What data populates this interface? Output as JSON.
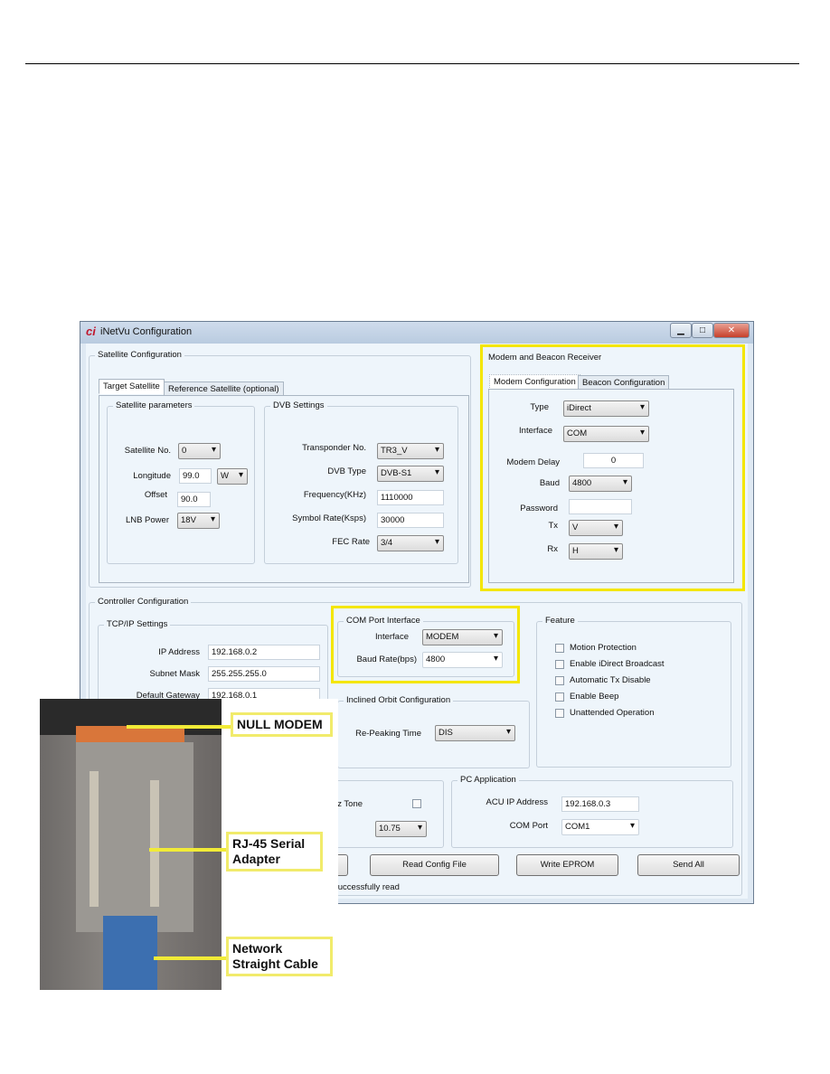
{
  "window": {
    "title": "iNetVu Configuration",
    "logo": "ci",
    "controls": [
      "minimize-icon",
      "maximize-icon",
      "close-icon"
    ],
    "control_glyphs": [
      "▁",
      "□",
      "✕"
    ]
  },
  "satellite": {
    "group": "Satellite Configuration",
    "tabs": [
      "Target Satellite",
      "Reference Satellite (optional)"
    ],
    "params": {
      "group": "Satellite parameters",
      "sat_no_label": "Satellite No.",
      "sat_no": "0",
      "longitude_label": "Longitude",
      "longitude": "99.0",
      "hemisphere": "W",
      "offset_label": "Offset",
      "offset": "90.0",
      "lnb_label": "LNB Power",
      "lnb": "18V"
    },
    "dvb": {
      "group": "DVB Settings",
      "transponder_label": "Transponder No.",
      "transponder": "TR3_V",
      "type_label": "DVB Type",
      "type": "DVB-S1",
      "freq_label": "Frequency(KHz)",
      "freq": "1110000",
      "symbol_label": "Symbol Rate(Ksps)",
      "symbol": "30000",
      "fec_label": "FEC Rate",
      "fec": "3/4"
    }
  },
  "modem": {
    "group": "Modem and Beacon Receiver",
    "tabs": [
      "Modem Configuration",
      "Beacon Configuration"
    ],
    "type_label": "Type",
    "type": "iDirect",
    "interface_label": "Interface",
    "interface": "COM",
    "delay_label": "Modem Delay",
    "delay": "0",
    "baud_label": "Baud",
    "baud": "4800",
    "password_label": "Password",
    "password": "",
    "tx_label": "Tx",
    "tx": "V",
    "rx_label": "Rx",
    "rx": "H"
  },
  "controller": {
    "group": "Controller Configuration",
    "tcpip": {
      "group": "TCP/IP Settings",
      "ip_label": "IP Address",
      "ip": "192.168.0.2",
      "mask_label": "Subnet Mask",
      "mask": "255.255.255.0",
      "gw_label": "Default Gateway",
      "gw": "192.168.0.1"
    },
    "com": {
      "group": "COM Port Interface",
      "interface_label": "Interface",
      "interface": "MODEM",
      "baud_label": "Baud Rate(bps)",
      "baud": "4800"
    },
    "orbit": {
      "group": "Inclined Orbit Configuration",
      "repeak_label": "Re-Peaking Time",
      "repeak": "DIS"
    },
    "feature": {
      "group": "Feature",
      "items": [
        "Motion Protection",
        "Enable iDirect Broadcast",
        "Automatic Tx Disable",
        "Enable Beep",
        "Unattended Operation"
      ]
    },
    "lnb": {
      "tone_label": "KHz Tone",
      "lo_value": "10.75"
    },
    "pc": {
      "group": "PC Application",
      "acu_label": "ACU IP Address",
      "acu": "192.168.0.3",
      "com_label": "COM Port",
      "com": "COM1"
    }
  },
  "buttons": {
    "read": "Read Config File",
    "write": "Write EPROM",
    "send": "Send All"
  },
  "status": "successfully read",
  "callouts": {
    "null_modem": "NULL MODEM",
    "rj45": "RJ-45 Serial Adapter",
    "cable": "Network Straight Cable"
  },
  "colors": {
    "highlight": "#f4e600"
  }
}
